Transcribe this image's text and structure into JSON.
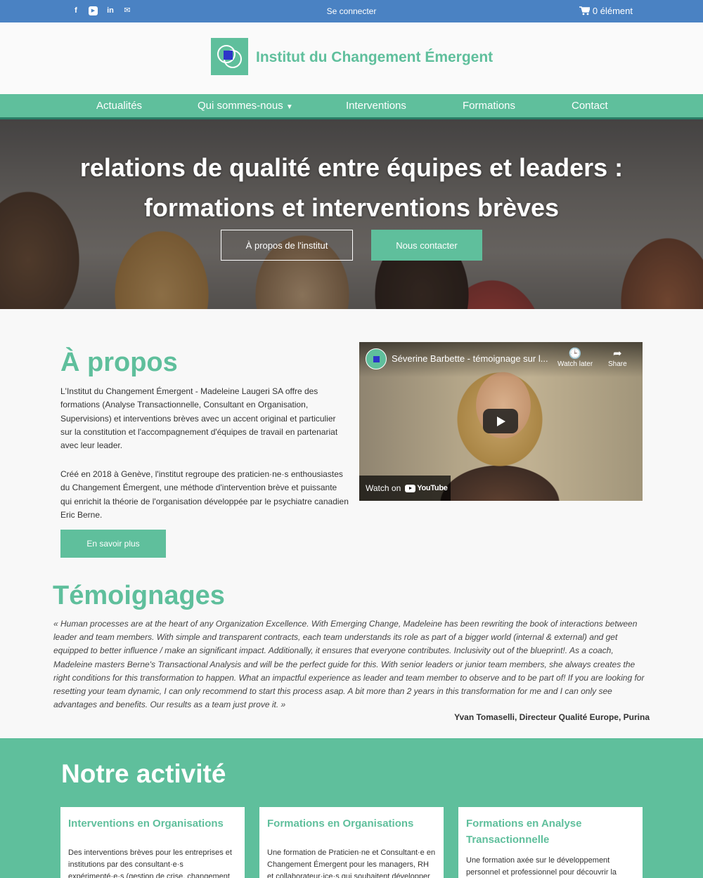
{
  "topbar": {
    "social": [
      "f",
      "▶",
      "in",
      "✉"
    ],
    "login": "Se connecter",
    "cart": "0 élément"
  },
  "header": {
    "title": "Institut du Changement Émergent"
  },
  "nav": {
    "items": [
      "Actualités",
      "Qui sommes-nous",
      "Interventions",
      "Formations",
      "Contact"
    ]
  },
  "hero": {
    "line1": "relations de qualité entre équipes et leaders :",
    "line2": "formations et interventions brèves",
    "btn_about": "À propos de l'institut",
    "btn_contact": "Nous contacter"
  },
  "about": {
    "title": "À propos",
    "p1": "L'Institut du Changement Émergent - Madeleine Laugeri SA offre des formations (Analyse Transactionnelle, Consultant en Organisation, Supervisions) et interventions brèves avec un accent original et particulier sur la constitution et l'accompagnement d'équipes de travail en partenariat avec leur leader.",
    "p2": "Créé en 2018 à Genève, l'institut regroupe des praticien·ne·s enthousiastes du Changement Émergent, une méthode d'intervention brève et puissante qui enrichit la théorie de l'organisation développée par le psychiatre canadien Eric Berne.",
    "btn_more": "En savoir plus"
  },
  "video": {
    "title": "Séverine Barbette - témoignage sur l...",
    "watch_later": "Watch later",
    "share": "Share",
    "watch_on": "Watch on",
    "youtube": "YouTube"
  },
  "testimonials": {
    "title": "Témoignages",
    "quote": "« Human processes are at the heart of any Organization Excellence. With Emerging Change, Madeleine has been rewriting the book of interactions between leader and team members. With simple and transparent contracts, each team understands its role as part of a bigger world (internal & external) and get equipped to better influence / make an significant impact. Additionally, it ensures that everyone contributes. Inclusivity out of the blueprint!. As a coach, Madeleine masters Berne's Transactional Analysis and will be the perfect guide for this. With senior leaders or junior team members, she always creates the right conditions for this transformation to happen. What an impactful experience as leader and team member to observe and to be part of! If you are looking for resetting your team dynamic, I can only recommend to start this process asap. A bit more than 2 years in this transformation for me and I can only see advantages and benefits. Our results as a team just prove it.  »",
    "author": "Yvan Tomaselli, Directeur Qualité Europe, Purina"
  },
  "activity": {
    "title": "Notre activité",
    "cards": [
      {
        "title": "Interventions en Organisations",
        "desc": "Des interventions brèves pour les entreprises et institutions par des consultant·e·s expérimenté·e·s (gestion de crise, changement de"
      },
      {
        "title": "Formations en Organisations",
        "desc": "Une formation de Praticien·ne et Consultant·e en Changement Émergent pour les managers, RH et collaborateur·ice·s qui souhaitent développer la"
      },
      {
        "title": "Formations en Analyse Transactionnelle",
        "desc": "Une formation axée sur le développement personnel et professionnel pour découvrir la"
      }
    ]
  },
  "colors": {
    "topbar": "#4a82c3",
    "brand_green": "#5fbf9c",
    "nav_border": "#2a7c65",
    "logo_square": "#2d35c9"
  }
}
